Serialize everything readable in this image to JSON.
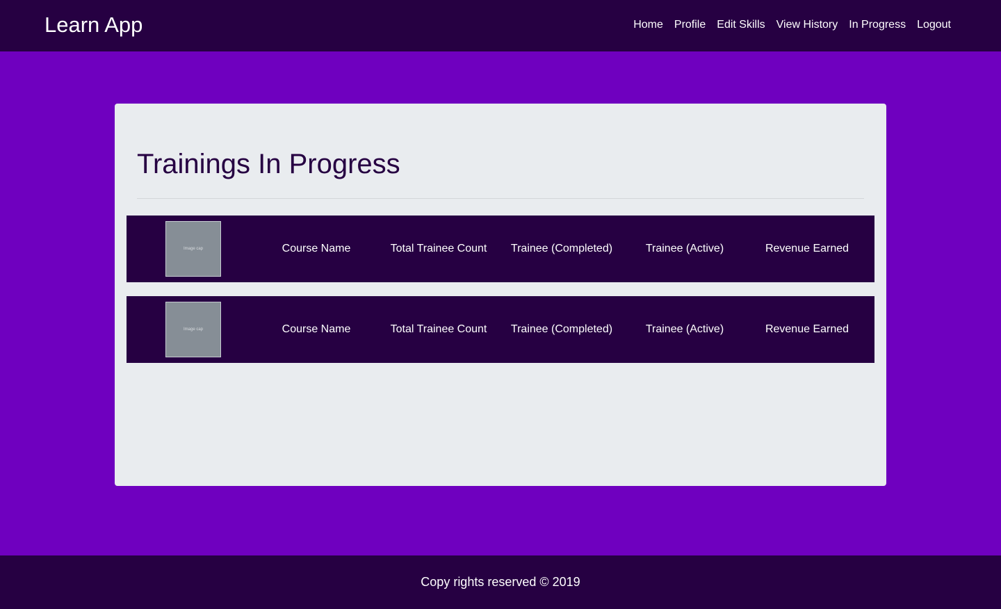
{
  "app": {
    "brand": "Learn App"
  },
  "nav": {
    "items": [
      {
        "label": "Home"
      },
      {
        "label": "Profile"
      },
      {
        "label": "Edit Skills"
      },
      {
        "label": "View History"
      },
      {
        "label": "In Progress"
      },
      {
        "label": "Logout"
      }
    ]
  },
  "main": {
    "title": "Trainings In Progress",
    "rows": [
      {
        "image_caption": "Image cap",
        "course_name": "Course Name",
        "total_trainee_count": "Total Trainee Count",
        "trainee_completed": "Trainee (Completed)",
        "trainee_active": "Trainee (Active)",
        "revenue_earned": "Revenue Earned"
      },
      {
        "image_caption": "Image cap",
        "course_name": "Course Name",
        "total_trainee_count": "Total Trainee Count",
        "trainee_completed": "Trainee (Completed)",
        "trainee_active": "Trainee (Active)",
        "revenue_earned": "Revenue Earned"
      }
    ]
  },
  "footer": {
    "text": "Copy rights reserved © 2019"
  },
  "colors": {
    "page_background": "#6f00bf",
    "navbar_background": "#260042",
    "card_background": "#e9ecef",
    "row_background": "#260042",
    "thumbnail_background": "#868e96",
    "title_color": "#260042",
    "text_on_dark": "#ffffff"
  }
}
